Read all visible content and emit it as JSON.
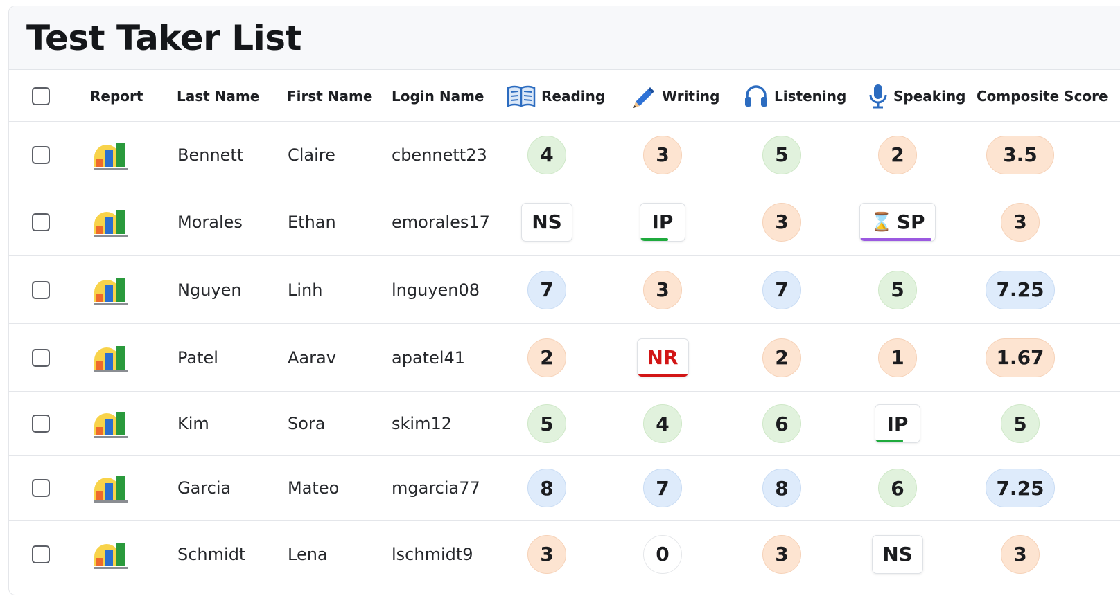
{
  "title": "Test Taker List",
  "columns": {
    "report": "Report",
    "last_name": "Last Name",
    "first_name": "First Name",
    "login_name": "Login Name",
    "reading": "Reading",
    "writing": "Writing",
    "listening": "Listening",
    "speaking": "Speaking",
    "composite": "Composite Score"
  },
  "icons": {
    "reading": "book-icon",
    "writing": "pencil-icon",
    "listening": "headphones-icon",
    "speaking": "microphone-icon",
    "report": "bar-chart-icon",
    "pending": "hourglass-icon"
  },
  "colors": {
    "score_green": "#e1f2dd",
    "score_orange": "#fde4d1",
    "score_blue": "#deebfb",
    "progress_green": "#1faa3d",
    "progress_purple": "#9b59e0",
    "not_rated_red": "#d21515"
  },
  "rows": [
    {
      "last": "Bennett",
      "first": "Claire",
      "login": "cbennett23",
      "reading": {
        "kind": "score",
        "value": "4",
        "color": "green"
      },
      "writing": {
        "kind": "score",
        "value": "3",
        "color": "orange"
      },
      "listening": {
        "kind": "score",
        "value": "5",
        "color": "green"
      },
      "speaking": {
        "kind": "score",
        "value": "2",
        "color": "orange"
      },
      "composite": {
        "kind": "score",
        "value": "3.5",
        "color": "orange"
      }
    },
    {
      "last": "Morales",
      "first": "Ethan",
      "login": "emorales17",
      "reading": {
        "kind": "status",
        "value": "NS"
      },
      "writing": {
        "kind": "status",
        "value": "IP",
        "progress": 0.62,
        "bar_color": "#1faa3d"
      },
      "listening": {
        "kind": "score",
        "value": "3",
        "color": "orange"
      },
      "speaking": {
        "kind": "status",
        "value": "SP",
        "icon": "hourglass-icon",
        "progress": 0.96,
        "bar_color": "#9b59e0"
      },
      "composite": {
        "kind": "score",
        "value": "3",
        "color": "orange"
      }
    },
    {
      "last": "Nguyen",
      "first": "Linh",
      "login": "lnguyen08",
      "reading": {
        "kind": "score",
        "value": "7",
        "color": "blue"
      },
      "writing": {
        "kind": "score",
        "value": "3",
        "color": "orange"
      },
      "listening": {
        "kind": "score",
        "value": "7",
        "color": "blue"
      },
      "speaking": {
        "kind": "score",
        "value": "5",
        "color": "green"
      },
      "composite": {
        "kind": "score",
        "value": "7.25",
        "color": "blue"
      }
    },
    {
      "last": "Patel",
      "first": "Aarav",
      "login": "apatel41",
      "reading": {
        "kind": "score",
        "value": "2",
        "color": "orange"
      },
      "writing": {
        "kind": "status",
        "value": "NR",
        "style": "red",
        "progress": 1.0,
        "bar_color": "#d21515"
      },
      "listening": {
        "kind": "score",
        "value": "2",
        "color": "orange"
      },
      "speaking": {
        "kind": "score",
        "value": "1",
        "color": "orange"
      },
      "composite": {
        "kind": "score",
        "value": "1.67",
        "color": "orange"
      }
    },
    {
      "last": "Kim",
      "first": "Sora",
      "login": "skim12",
      "reading": {
        "kind": "score",
        "value": "5",
        "color": "green"
      },
      "writing": {
        "kind": "score",
        "value": "4",
        "color": "green"
      },
      "listening": {
        "kind": "score",
        "value": "6",
        "color": "green"
      },
      "speaking": {
        "kind": "status",
        "value": "IP",
        "progress": 0.62,
        "bar_color": "#1faa3d"
      },
      "composite": {
        "kind": "score",
        "value": "5",
        "color": "green"
      }
    },
    {
      "last": "Garcia",
      "first": "Mateo",
      "login": "mgarcia77",
      "reading": {
        "kind": "score",
        "value": "8",
        "color": "blue"
      },
      "writing": {
        "kind": "score",
        "value": "7",
        "color": "blue"
      },
      "listening": {
        "kind": "score",
        "value": "8",
        "color": "blue"
      },
      "speaking": {
        "kind": "score",
        "value": "6",
        "color": "green"
      },
      "composite": {
        "kind": "score",
        "value": "7.25",
        "color": "blue"
      }
    },
    {
      "last": "Schmidt",
      "first": "Lena",
      "login": "lschmidt9",
      "reading": {
        "kind": "score",
        "value": "3",
        "color": "orange"
      },
      "writing": {
        "kind": "score",
        "value": "0",
        "color": "white"
      },
      "listening": {
        "kind": "score",
        "value": "3",
        "color": "orange"
      },
      "speaking": {
        "kind": "status",
        "value": "NS"
      },
      "composite": {
        "kind": "score",
        "value": "3",
        "color": "orange"
      }
    }
  ]
}
